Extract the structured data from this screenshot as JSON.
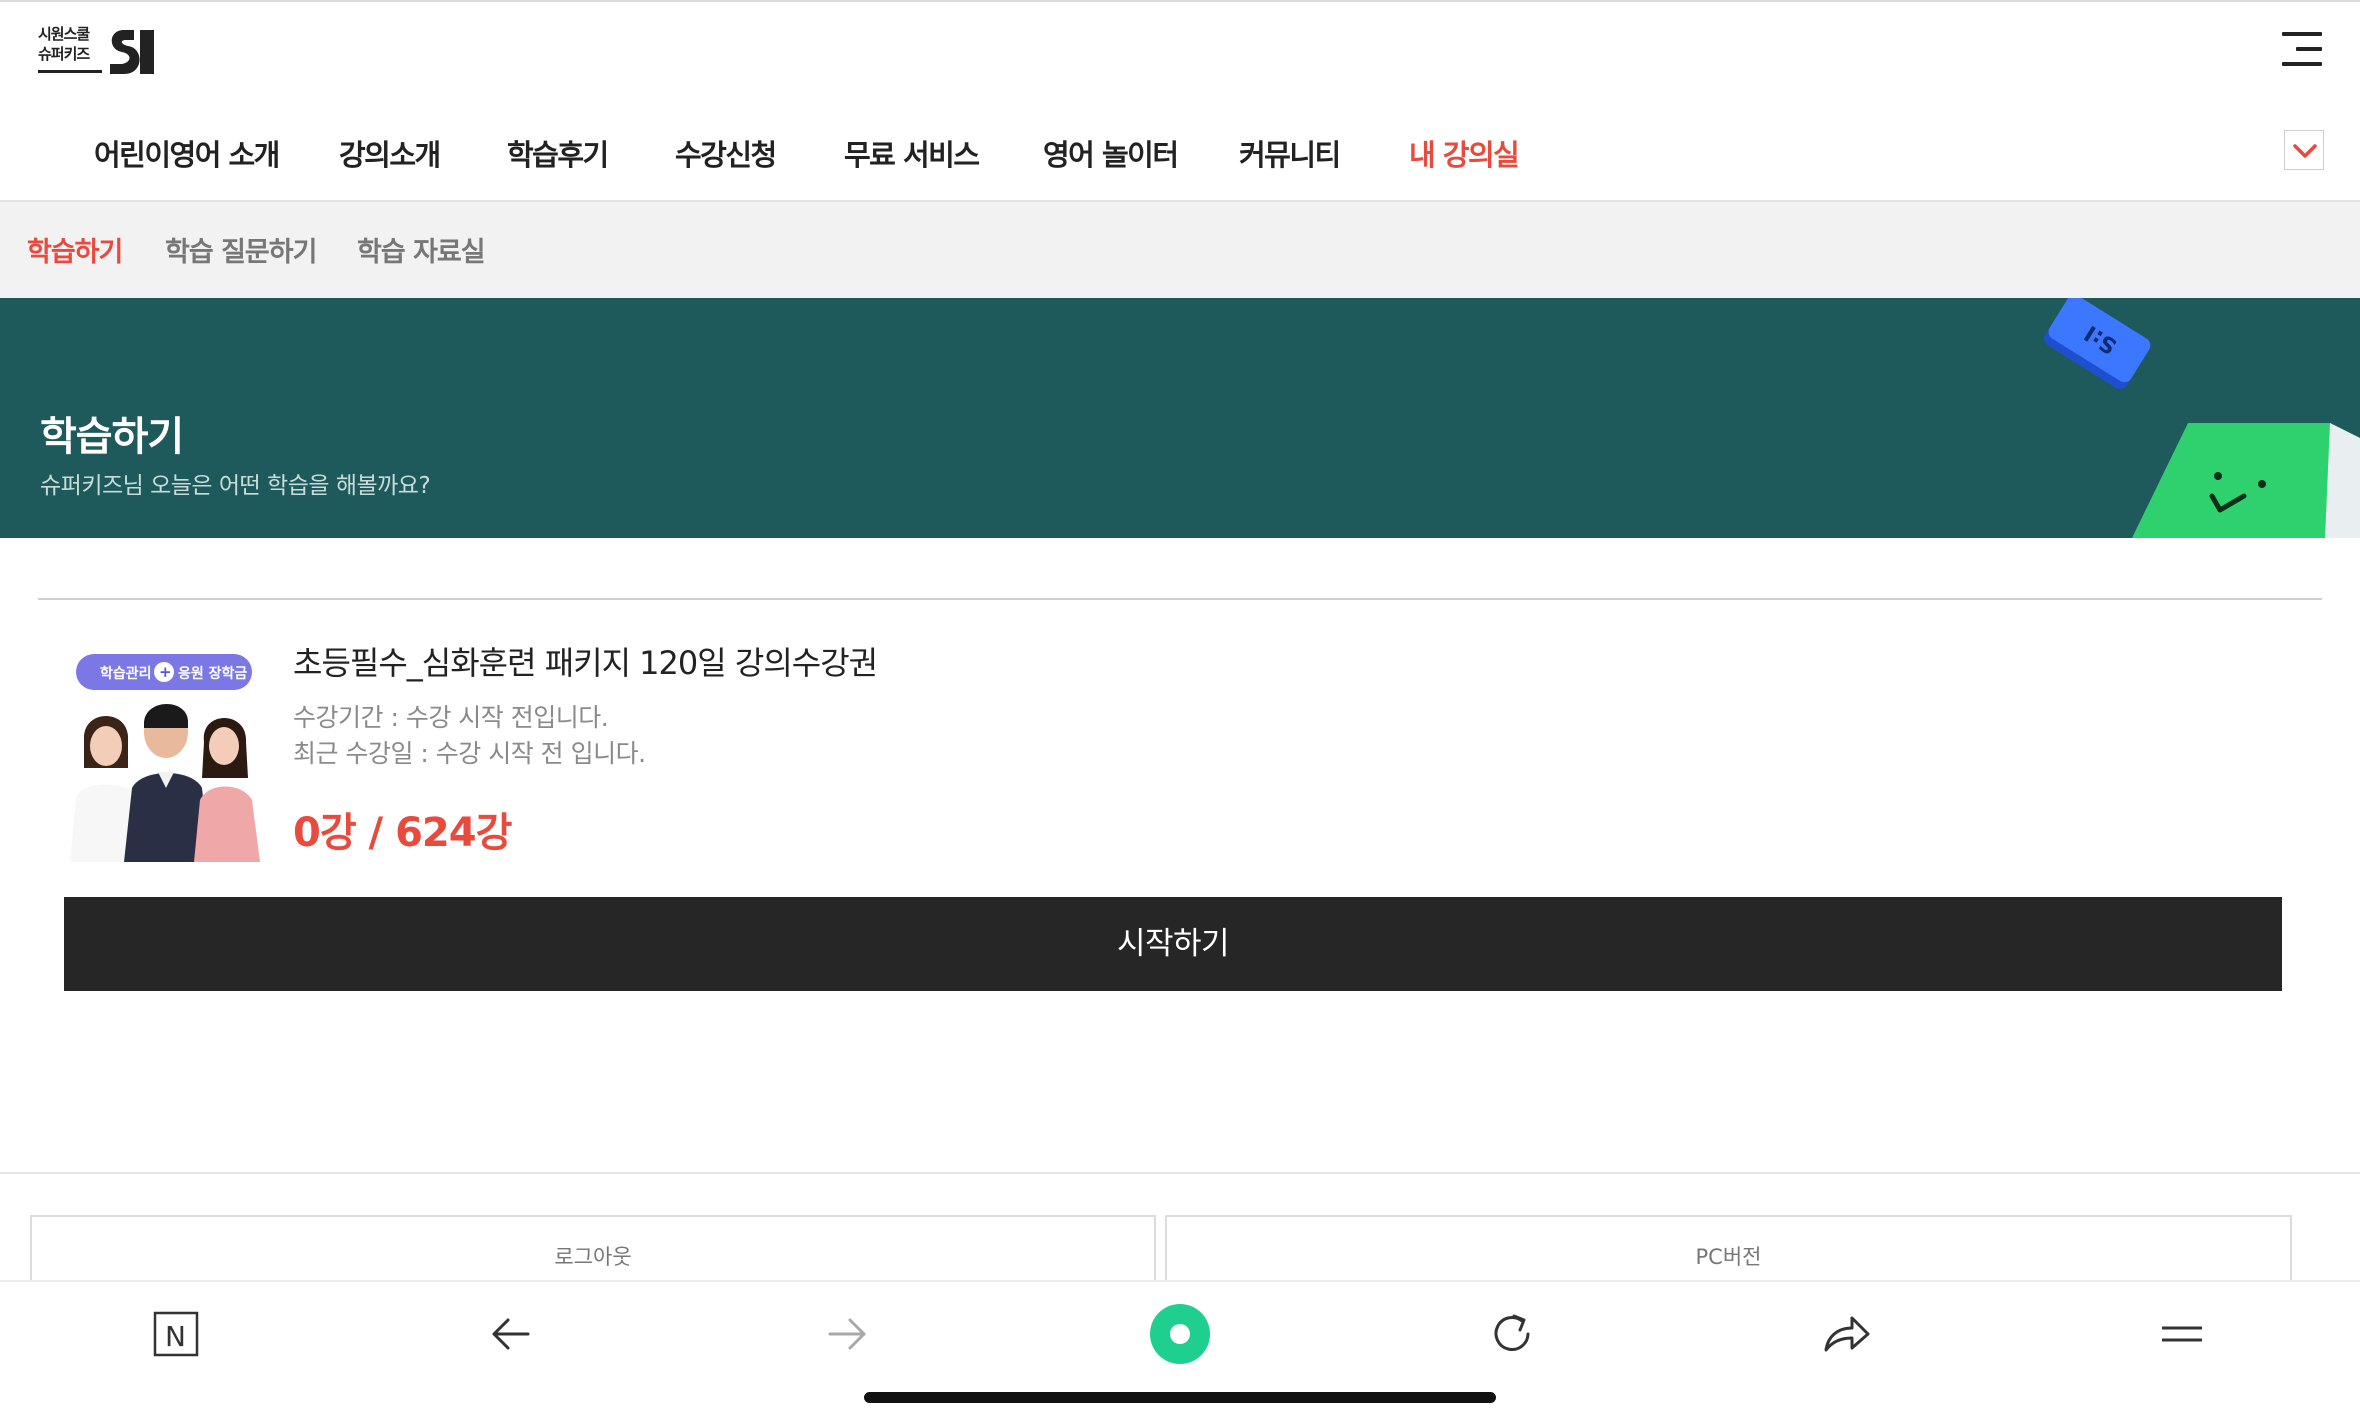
{
  "header": {
    "logo_line1": "시원스쿨",
    "logo_line2": "슈퍼키즈",
    "menu_icon": "hamburger-icon"
  },
  "gnb": {
    "items": [
      {
        "label": "어린이영어 소개",
        "active": false
      },
      {
        "label": "강의소개",
        "active": false
      },
      {
        "label": "학습후기",
        "active": false
      },
      {
        "label": "수강신청",
        "active": false
      },
      {
        "label": "무료 서비스",
        "active": false
      },
      {
        "label": "영어 놀이터",
        "active": false
      },
      {
        "label": "커뮤니티",
        "active": false
      },
      {
        "label": "내 강의실",
        "active": true
      }
    ],
    "toggle_icon": "chevron-down-icon"
  },
  "subnav": {
    "items": [
      {
        "label": "학습하기",
        "active": true
      },
      {
        "label": "학습 질문하기",
        "active": false
      },
      {
        "label": "학습 자료실",
        "active": false
      }
    ]
  },
  "banner": {
    "title": "학습하기",
    "subtitle": "슈퍼키즈님 오늘은 어떤 학습을 해볼까요?",
    "deco_text": "S:I"
  },
  "course": {
    "badge_left": "학습관리",
    "badge_plus": "+",
    "badge_right": "응원 장학금",
    "title": "초등필수_심화훈련 패키지 120일 강의수강권",
    "period": "수강기간 : 수강 시작 전입니다.",
    "recent": "최근 수강일 : 수강 시작 전 입니다.",
    "progress": "0강 / 624강",
    "start_label": "시작하기"
  },
  "footer": {
    "logout_label": "로그아웃",
    "pc_label": "PC버전"
  },
  "toolbar": {
    "n_label": "N",
    "icons": [
      "naver-icon",
      "back-arrow-icon",
      "forward-arrow-icon",
      "green-dot-icon",
      "refresh-icon",
      "share-icon",
      "menu-icon"
    ]
  },
  "colors": {
    "accent": "#e84a3e",
    "banner_bg": "#1e5a5c",
    "button_bg": "#262626",
    "green": "#1fcf8f"
  }
}
